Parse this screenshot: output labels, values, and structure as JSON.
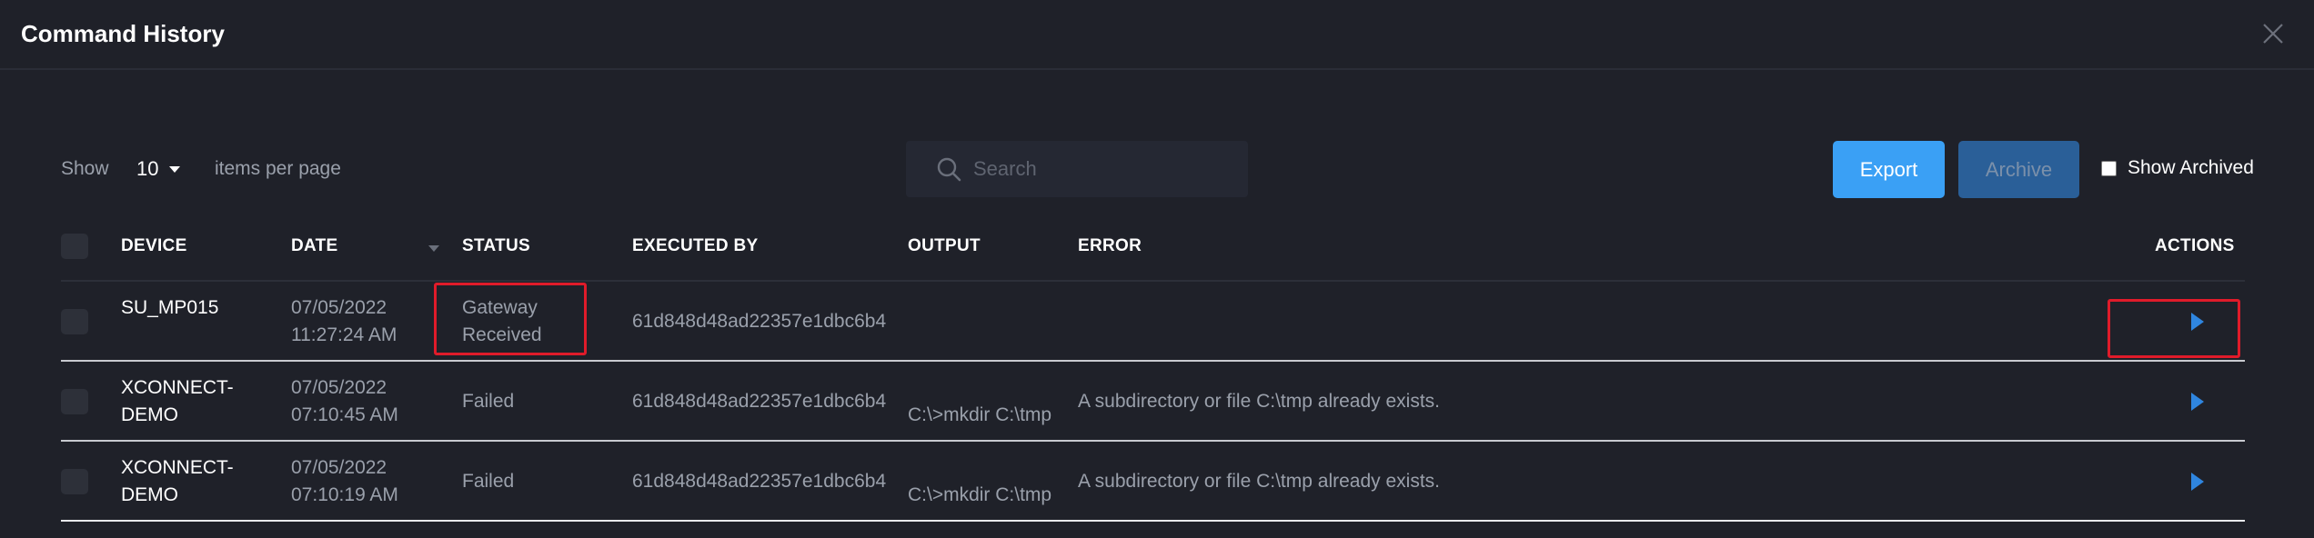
{
  "modal": {
    "title": "Command History"
  },
  "toolbar": {
    "show_label": "Show",
    "page_size": "10",
    "items_per_page_label": "items per page",
    "search_placeholder": "Search",
    "export_label": "Export",
    "archive_label": "Archive",
    "show_archived_label": "Show Archived"
  },
  "table": {
    "headers": {
      "device": "DEVICE",
      "date": "DATE",
      "status": "STATUS",
      "executed_by": "EXECUTED BY",
      "output": "OUTPUT",
      "error": "ERROR",
      "actions": "ACTIONS"
    },
    "rows": [
      {
        "device_line1": "SU_MP015",
        "device_line2": "",
        "date": "07/05/2022",
        "time": "11:27:24 AM",
        "status_line1": "Gateway",
        "status_line2": "Received",
        "executed_by": "61d848d48ad22357e1dbc6b4",
        "output": "",
        "error": ""
      },
      {
        "device_line1": "XCONNECT-",
        "device_line2": "DEMO",
        "date": "07/05/2022",
        "time": "07:10:45 AM",
        "status_line1": "Failed",
        "status_line2": "",
        "executed_by": "61d848d48ad22357e1dbc6b4",
        "output": "C:\\>mkdir C:\\tmp",
        "error": "A subdirectory or file C:\\tmp already exists."
      },
      {
        "device_line1": "XCONNECT-",
        "device_line2": "DEMO",
        "date": "07/05/2022",
        "time": "07:10:19 AM",
        "status_line1": "Failed",
        "status_line2": "",
        "executed_by": "61d848d48ad22357e1dbc6b4",
        "output": "C:\\>mkdir C:\\tmp",
        "error": "A subdirectory or file C:\\tmp already exists."
      }
    ]
  },
  "colors": {
    "background": "#1f2129",
    "primary": "#3aa0f5",
    "archive": "#2a5f98",
    "highlight": "#e01b2a",
    "play_icon": "#2f86e0"
  }
}
